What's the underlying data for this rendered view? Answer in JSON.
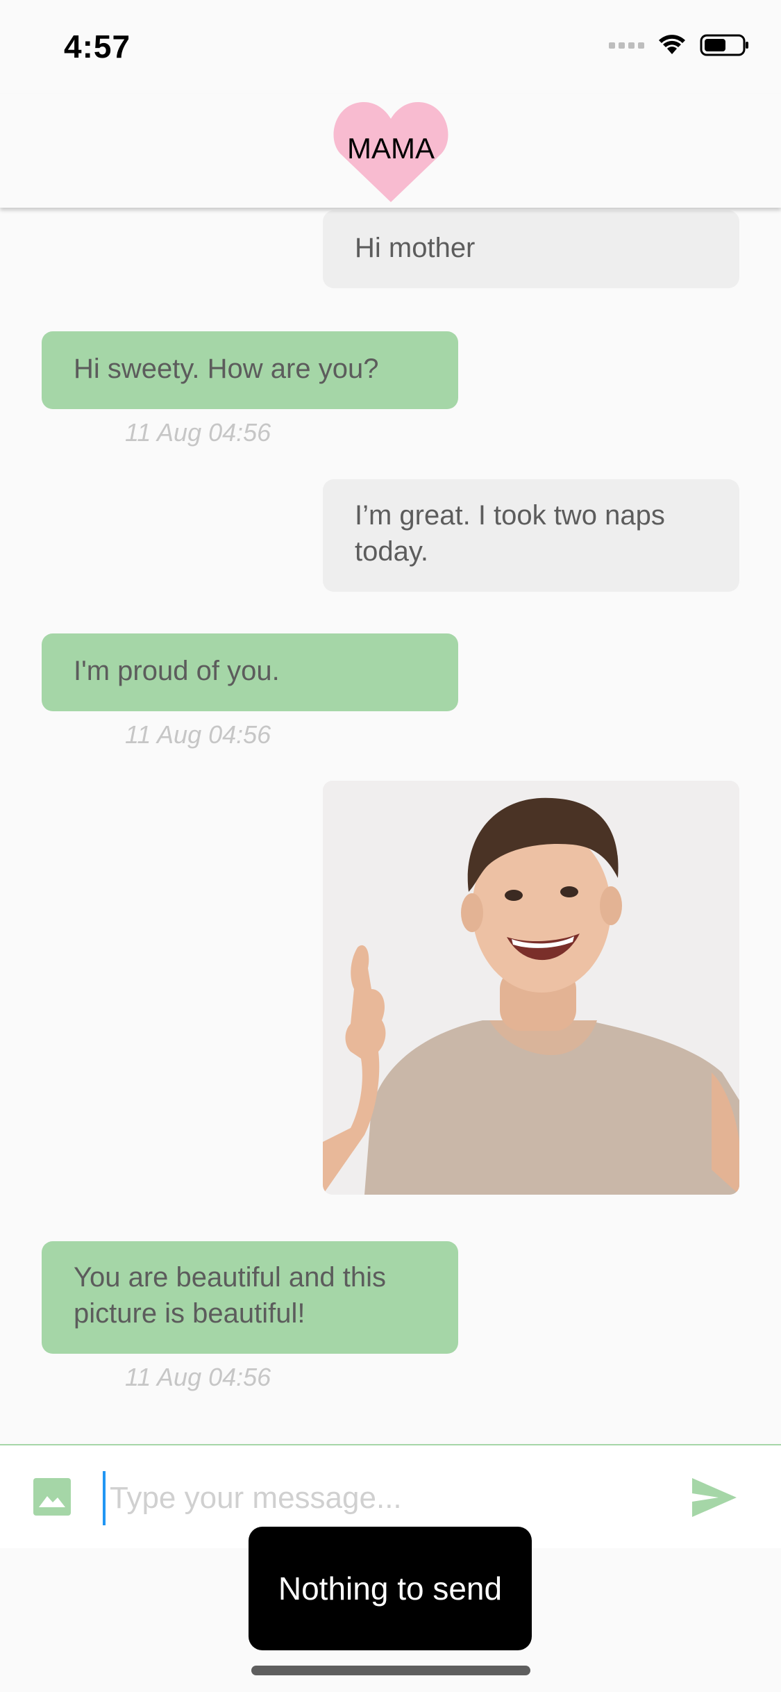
{
  "status_bar": {
    "time": "4:57"
  },
  "header": {
    "contact_name": "MAMA",
    "heart_color": "#f8bbd0"
  },
  "messages": [
    {
      "from": "me",
      "text": "Hi mother"
    },
    {
      "from": "mama",
      "text": "Hi sweety. How are you?",
      "time": "11 Aug 04:56"
    },
    {
      "from": "me",
      "text": "I’m great. I took two naps today."
    },
    {
      "from": "mama",
      "text": "I'm proud of you.",
      "time": "11 Aug 04:56"
    },
    {
      "from": "me",
      "type": "image"
    },
    {
      "from": "mama",
      "text": "You are beautiful and this picture is beautiful!",
      "time": "11 Aug 04:56"
    }
  ],
  "composer": {
    "placeholder": "Type your message...",
    "value": ""
  },
  "toast": {
    "text": "Nothing to send"
  },
  "colors": {
    "accent": "#a5d6a7",
    "my_bubble": "#eeeeee",
    "their_bubble": "#a5d6a7",
    "caret": "#2196f3"
  },
  "icons": {
    "attach": "image-icon",
    "send": "send-icon"
  }
}
